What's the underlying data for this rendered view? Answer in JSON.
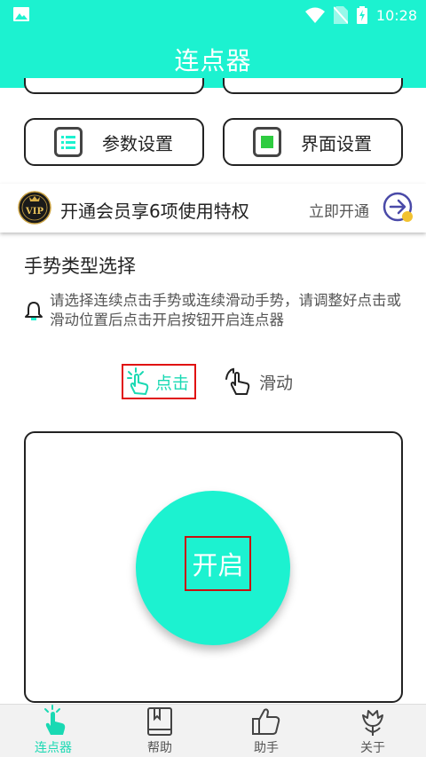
{
  "status_bar": {
    "time": "10:28"
  },
  "app_bar": {
    "title": "连点器"
  },
  "settings": {
    "params_label": "参数设置",
    "ui_label": "界面设置"
  },
  "vip": {
    "badge_text": "VIP",
    "promo_text": "开通会员享6项使用特权",
    "open_label": "立即开通"
  },
  "gesture": {
    "title": "手势类型选择",
    "hint": "请选择连续点击手势或连续滑动手势，请调整好点击或滑动位置后点击开启按钮开启连点器",
    "tab_click": "点击",
    "tab_swipe": "滑动",
    "selected": "点击"
  },
  "start_button": {
    "label": "开启"
  },
  "bottom_nav": {
    "items": [
      {
        "label": "连点器",
        "icon": "tap-hand-icon"
      },
      {
        "label": "帮助",
        "icon": "book-icon"
      },
      {
        "label": "助手",
        "icon": "thumbs-up-icon"
      },
      {
        "label": "关于",
        "icon": "flower-icon"
      }
    ]
  },
  "colors": {
    "accent": "#1cf2d0",
    "accent_text": "#1ad9b3",
    "highlight_border": "#e01010"
  }
}
